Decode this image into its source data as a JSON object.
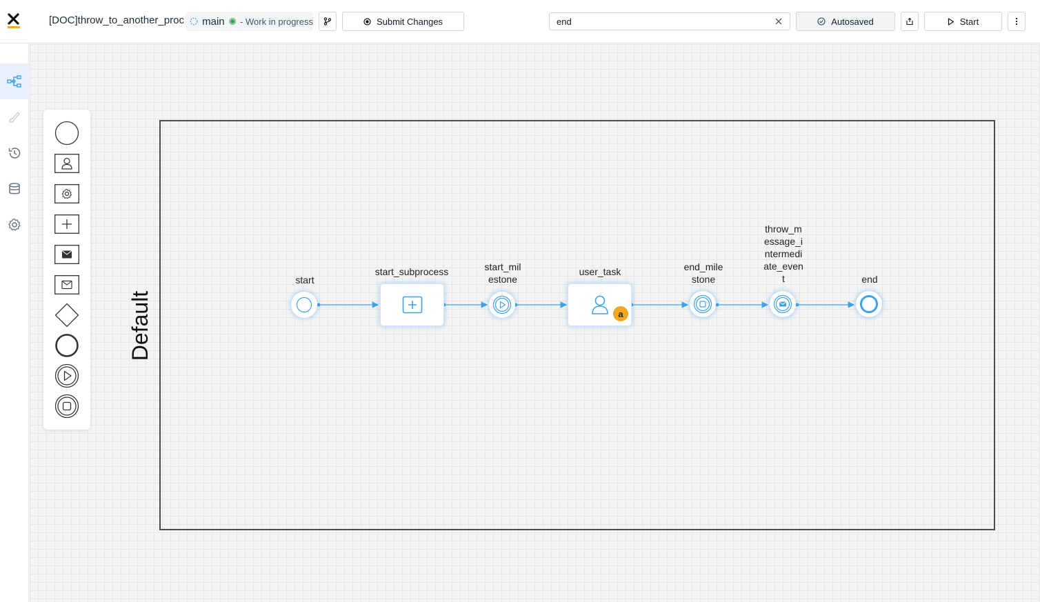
{
  "header": {
    "process_title": "[DOC]throw_to_another_proc",
    "branch": "main",
    "branch_status": "- Work in progress",
    "submit_label": "Submit Changes",
    "autosaved_label": "Autosaved",
    "start_label": "Start"
  },
  "search": {
    "value": "end",
    "placeholder": ""
  },
  "sidebar": {
    "items": [
      {
        "icon": "process-diagram-icon",
        "active": true
      },
      {
        "icon": "brush-icon",
        "active": false
      },
      {
        "icon": "history-icon",
        "active": false
      },
      {
        "icon": "database-icon",
        "active": false
      },
      {
        "icon": "settings-gear-icon",
        "active": false
      }
    ]
  },
  "palette": {
    "items": [
      "start-event-icon",
      "user-task-icon",
      "service-task-icon",
      "subprocess-icon",
      "message-throw-icon",
      "message-catch-icon",
      "gateway-icon",
      "end-event-icon",
      "start-milestone-icon",
      "end-milestone-icon"
    ]
  },
  "diagram": {
    "pool_name": "Default",
    "nodes": [
      {
        "id": "start",
        "label": "start",
        "type": "start-event"
      },
      {
        "id": "start_subprocess",
        "label": "start_subprocess",
        "type": "subprocess"
      },
      {
        "id": "start_milestone",
        "label": "start_milestone",
        "type": "start-milestone"
      },
      {
        "id": "user_task",
        "label": "user_task",
        "type": "user-task",
        "badge": "a"
      },
      {
        "id": "end_milestone",
        "label": "end_milestone",
        "type": "end-milestone"
      },
      {
        "id": "throw_message",
        "label": "throw_message_intermediate_event",
        "type": "message-throw"
      },
      {
        "id": "end",
        "label": "end",
        "type": "end-event"
      }
    ]
  },
  "colors": {
    "accent": "#3da2e9",
    "badge": "#f5a623",
    "pool_border": "#4a4a4a"
  }
}
